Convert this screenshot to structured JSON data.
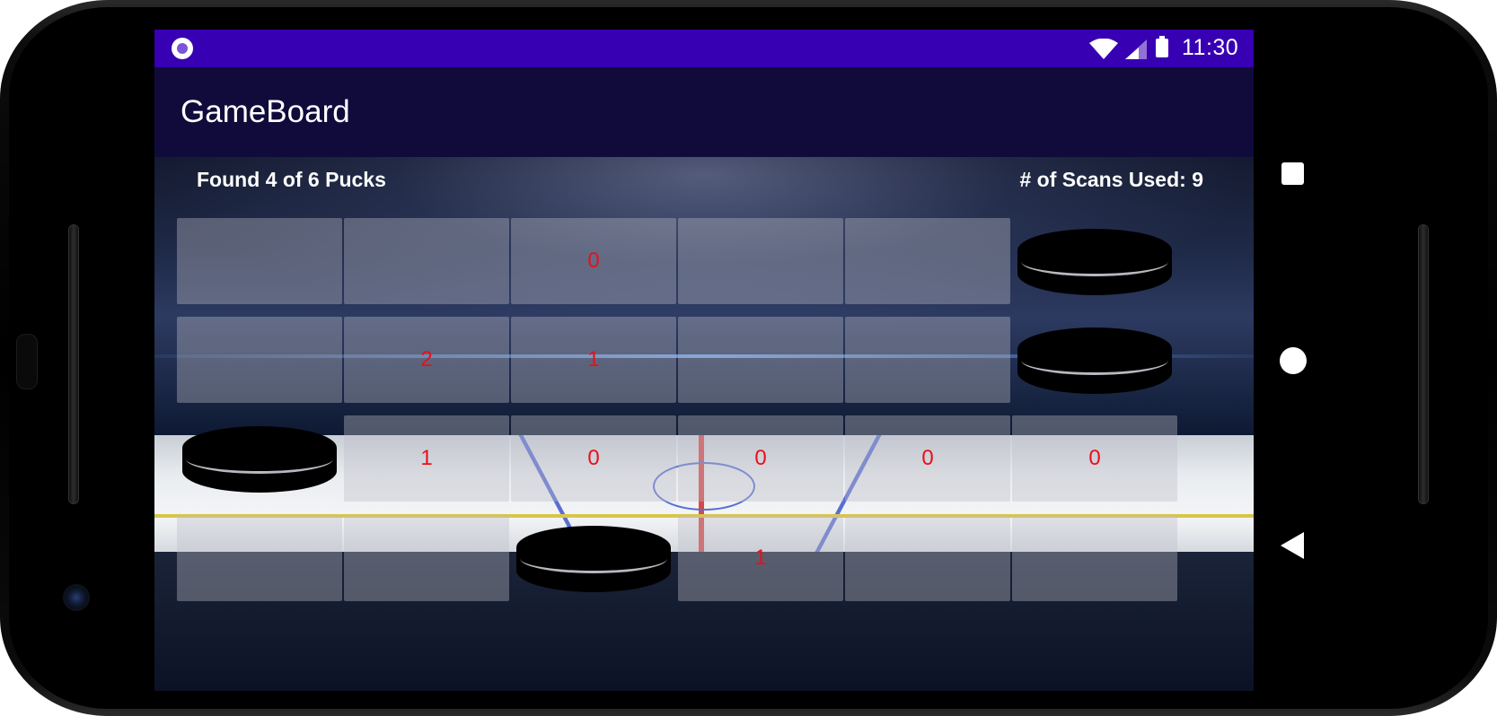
{
  "status_bar": {
    "time": "11:30",
    "icons": [
      "notification-dot-icon",
      "wifi-icon",
      "cell-signal-icon",
      "battery-icon"
    ]
  },
  "app_bar": {
    "title": "GameBoard"
  },
  "game": {
    "found_text": "Found 4 of 6 Pucks",
    "scans_text": "# of Scans Used: 9",
    "grid": [
      [
        {
          "state": "hidden",
          "value": ""
        },
        {
          "state": "hidden",
          "value": ""
        },
        {
          "state": "scanned",
          "value": "0"
        },
        {
          "state": "hidden",
          "value": ""
        },
        {
          "state": "hidden",
          "value": ""
        },
        {
          "state": "puck",
          "value": ""
        }
      ],
      [
        {
          "state": "hidden",
          "value": ""
        },
        {
          "state": "scanned",
          "value": "2"
        },
        {
          "state": "scanned",
          "value": "1"
        },
        {
          "state": "hidden",
          "value": ""
        },
        {
          "state": "hidden",
          "value": ""
        },
        {
          "state": "puck",
          "value": ""
        }
      ],
      [
        {
          "state": "puck",
          "value": ""
        },
        {
          "state": "scanned",
          "value": "1"
        },
        {
          "state": "scanned",
          "value": "0"
        },
        {
          "state": "scanned",
          "value": "0"
        },
        {
          "state": "scanned",
          "value": "0"
        },
        {
          "state": "scanned",
          "value": "0"
        }
      ],
      [
        {
          "state": "hidden",
          "value": ""
        },
        {
          "state": "hidden",
          "value": ""
        },
        {
          "state": "puck",
          "value": ""
        },
        {
          "state": "scanned",
          "value": "1"
        },
        {
          "state": "hidden",
          "value": ""
        },
        {
          "state": "hidden",
          "value": ""
        }
      ]
    ]
  },
  "nav_bar": {
    "buttons": [
      "recents-square-icon",
      "home-circle-icon",
      "back-triangle-icon"
    ]
  },
  "colors": {
    "status_bar": "#3700b3",
    "app_bar": "#100b3b",
    "number_text": "#e8101a"
  }
}
